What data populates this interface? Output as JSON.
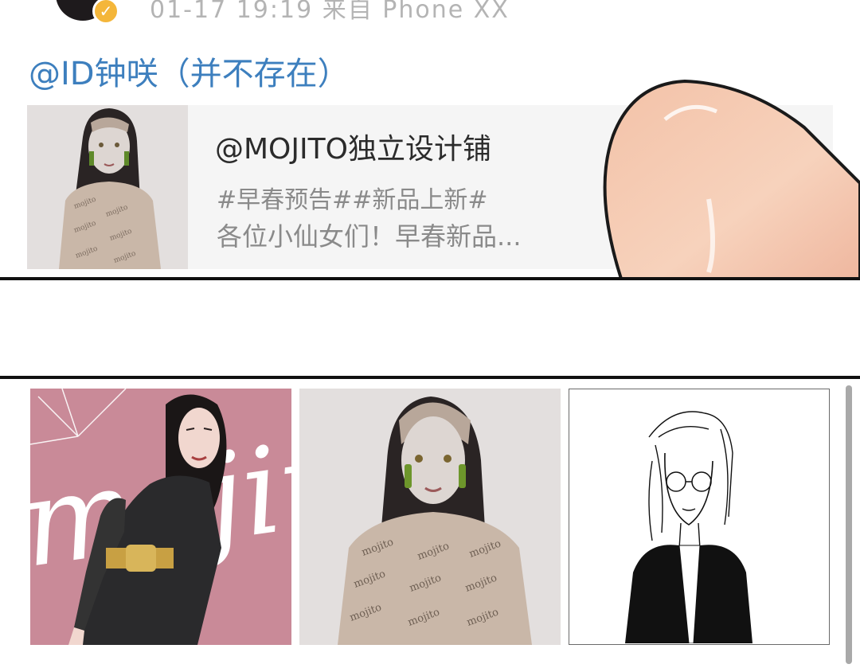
{
  "post": {
    "meta": "01-17 19:19  来自 Phone XX",
    "verified_icon": "verified-badge-icon",
    "mention": "@ID钟咲（并不存在）"
  },
  "share_card": {
    "account": "@MOJITO独立设计铺",
    "tags": "#早春预告##新品上新#",
    "excerpt": "各位小仙女们！早春新品..."
  },
  "grid": {
    "images": [
      {
        "name": "image-woman-black-dress",
        "alt": "woman in black dress on pink background"
      },
      {
        "name": "image-woman-mojito-top",
        "alt": "woman in mojito logo print top"
      },
      {
        "name": "image-woman-lineart",
        "alt": "line art woman with glasses"
      }
    ],
    "tile1_wordmark": "mojito"
  },
  "colors": {
    "link": "#3d7fbe",
    "meta": "#b4b4b4",
    "card_bg": "#f5f5f5",
    "pink": "#c98a98",
    "badge": "#f4b63a"
  }
}
